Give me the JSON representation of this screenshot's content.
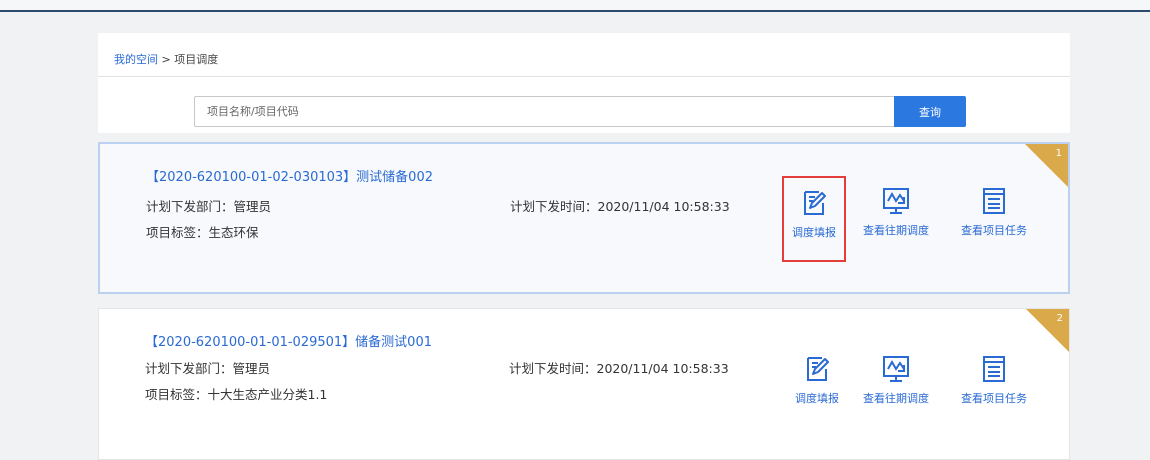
{
  "breadcrumb": {
    "home": "我的空间",
    "separator": ">",
    "current": "项目调度"
  },
  "search": {
    "placeholder": "项目名称/项目代码",
    "value": "",
    "button_label": "查询"
  },
  "projects": [
    {
      "index": "1",
      "title": "【2020-620100-01-02-030103】测试储备002",
      "dept": "计划下发部门：管理员",
      "time": "计划下发时间：2020/11/04 10:58:33",
      "tag": "项目标签：生态环保",
      "highlighted_action": "调度填报"
    },
    {
      "index": "2",
      "title": "【2020-620100-01-01-029501】储备测试001",
      "dept": "计划下发部门：管理员",
      "time": "计划下发时间：2020/11/04 10:58:33",
      "tag": "项目标签：十大生态产业分类1.1"
    }
  ],
  "actions": {
    "fill": "调度填报",
    "history": "查看往期调度",
    "tasks": "查看项目任务"
  },
  "colors": {
    "accent": "#2b79e0",
    "link": "#2a6ad3",
    "corner": "#d9a94a",
    "highlight": "#e53c3c"
  },
  "icons": {
    "fill": "edit-icon",
    "history": "chart-monitor-icon",
    "tasks": "task-list-icon"
  }
}
